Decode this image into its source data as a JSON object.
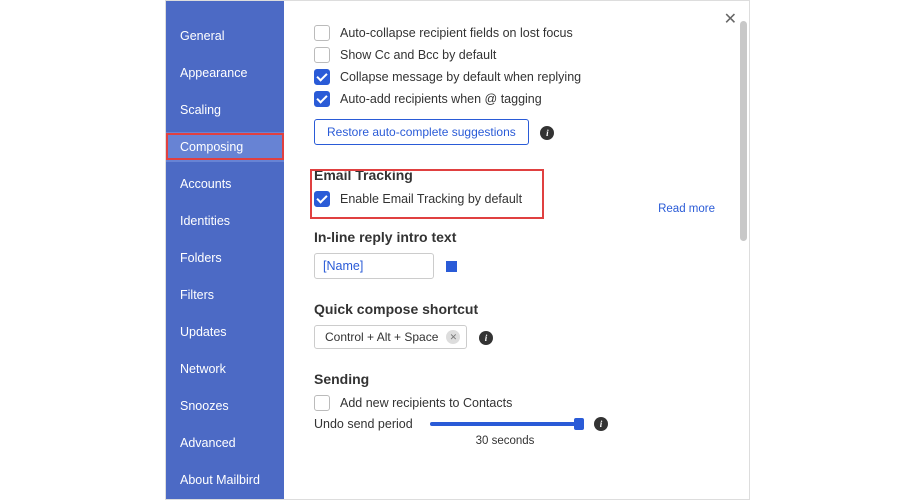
{
  "sidebar": {
    "items": [
      {
        "label": "General"
      },
      {
        "label": "Appearance"
      },
      {
        "label": "Scaling"
      },
      {
        "label": "Composing",
        "active": true
      },
      {
        "label": "Accounts"
      },
      {
        "label": "Identities"
      },
      {
        "label": "Folders"
      },
      {
        "label": "Filters"
      },
      {
        "label": "Updates"
      },
      {
        "label": "Network"
      },
      {
        "label": "Snoozes"
      },
      {
        "label": "Advanced"
      },
      {
        "label": "About Mailbird"
      }
    ]
  },
  "sections": {
    "composing_options": [
      {
        "label": "Auto-collapse recipient fields on lost focus",
        "checked": false
      },
      {
        "label": "Show Cc and Bcc by default",
        "checked": false
      },
      {
        "label": "Collapse message by default when replying",
        "checked": true
      },
      {
        "label": "Auto-add recipients when @ tagging",
        "checked": true
      }
    ],
    "restore_btn": "Restore auto-complete suggestions",
    "email_tracking": {
      "title": "Email Tracking",
      "option_label": "Enable Email Tracking by default",
      "option_checked": true,
      "read_more": "Read more"
    },
    "inline_reply": {
      "title": "In-line reply intro text",
      "value": "[Name]"
    },
    "quick_compose": {
      "title": "Quick compose shortcut",
      "value": "Control + Alt + Space"
    },
    "sending": {
      "title": "Sending",
      "option_label": "Add new recipients to Contacts",
      "option_checked": false,
      "undo_label": "Undo send period",
      "undo_value": "30 seconds"
    }
  },
  "close": "✕"
}
